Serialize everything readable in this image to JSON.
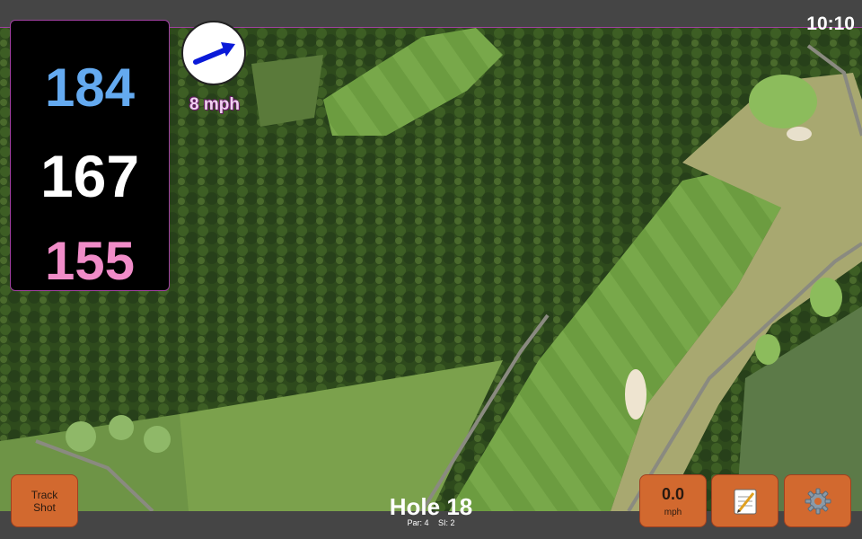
{
  "status_bar": {
    "time": "10:10"
  },
  "distances": {
    "back": "184",
    "center": "167",
    "front": "155"
  },
  "wind": {
    "speed_label": "8 mph",
    "arrow_icon": "arrow-right-icon"
  },
  "hole": {
    "title": "Hole 18",
    "par": "Par: 4",
    "si": "SI: 2"
  },
  "buttons": {
    "track_shot": {
      "line1": "Track",
      "line2": "Shot"
    },
    "speed": {
      "value": "0.0",
      "unit": "mph"
    },
    "notes_icon": "notepad-icon",
    "settings_icon": "gear-icon"
  },
  "colors": {
    "back": "#64aaf0",
    "center": "#ffffff",
    "front": "#f08cc8",
    "button": "#d2692f",
    "accent": "#a040a0"
  }
}
